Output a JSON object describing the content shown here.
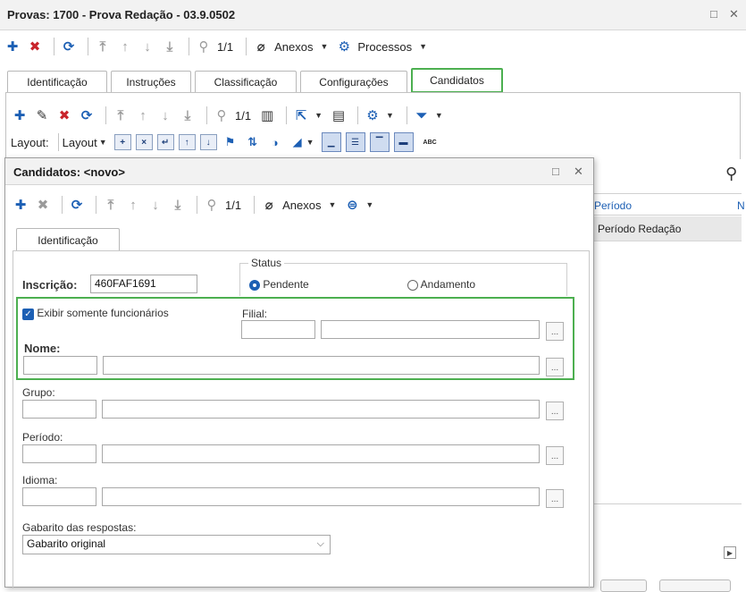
{
  "window": {
    "title": "Provas: 1700 - Prova Redação - 03.9.0502",
    "restore_glyph": "□",
    "close_glyph": "✕"
  },
  "main_toolbar": {
    "page": "1/1",
    "anexos": "Anexos",
    "processos": "Processos"
  },
  "tabs": [
    {
      "label": "Identificação"
    },
    {
      "label": "Instruções"
    },
    {
      "label": "Classificação"
    },
    {
      "label": "Configurações"
    },
    {
      "label": "Candidatos"
    }
  ],
  "list_toolbar": {
    "page": "1/1",
    "layout_label": "Layout:",
    "layout_dropdown": "Layout",
    "abc_label": "ABC"
  },
  "grid": {
    "columns": [
      "Período",
      "N"
    ],
    "rows": [
      [
        "Período Redação"
      ]
    ]
  },
  "dialog": {
    "title": "Candidatos: <novo>",
    "restore_glyph": "□",
    "close_glyph": "✕",
    "toolbar": {
      "page": "1/1",
      "anexos": "Anexos"
    },
    "tab": "Identificação",
    "inscricao_label": "Inscrição:",
    "inscricao_value": "460FAF1691",
    "status": {
      "legend": "Status",
      "options": [
        {
          "label": "Pendente",
          "selected": true
        },
        {
          "label": "Andamento",
          "selected": false
        }
      ]
    },
    "exibir_label": "Exibir somente funcionários",
    "filial_label": "Filial:",
    "nome_label": "Nome:",
    "grupo_label": "Grupo:",
    "periodo_label": "Período:",
    "idioma_label": "Idioma:",
    "gabarito_label": "Gabarito das respostas:",
    "gabarito_value": "Gabarito original",
    "ellipsis": "..."
  },
  "colors": {
    "accent": "#1c5fb4",
    "delete": "#c9252c",
    "highlight": "#4caf50"
  }
}
